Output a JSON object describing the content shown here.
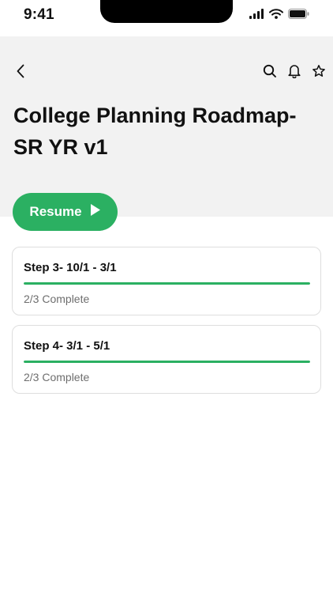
{
  "status_bar": {
    "time": "9:41",
    "icons": [
      "signal-icon",
      "wifi-icon",
      "battery-icon"
    ]
  },
  "header": {
    "back_icon": "chevron-left-icon",
    "actions": [
      "search-icon",
      "bell-icon",
      "star-icon"
    ],
    "title": "College Planning Roadmap-SR YR v1"
  },
  "resume": {
    "label": "Resume",
    "icon": "play-icon"
  },
  "steps": [
    {
      "title": "Step 3- 10/1 - 3/1",
      "status": "2/3 Complete",
      "progress": 1.0
    },
    {
      "title": "Step 4- 3/1 - 5/1",
      "status": "2/3 Complete",
      "progress": 1.0
    }
  ],
  "colors": {
    "accent": "#2bb062",
    "header_bg": "#f2f2f2",
    "card_border": "#dedede",
    "muted_text": "#6e6e6e"
  }
}
